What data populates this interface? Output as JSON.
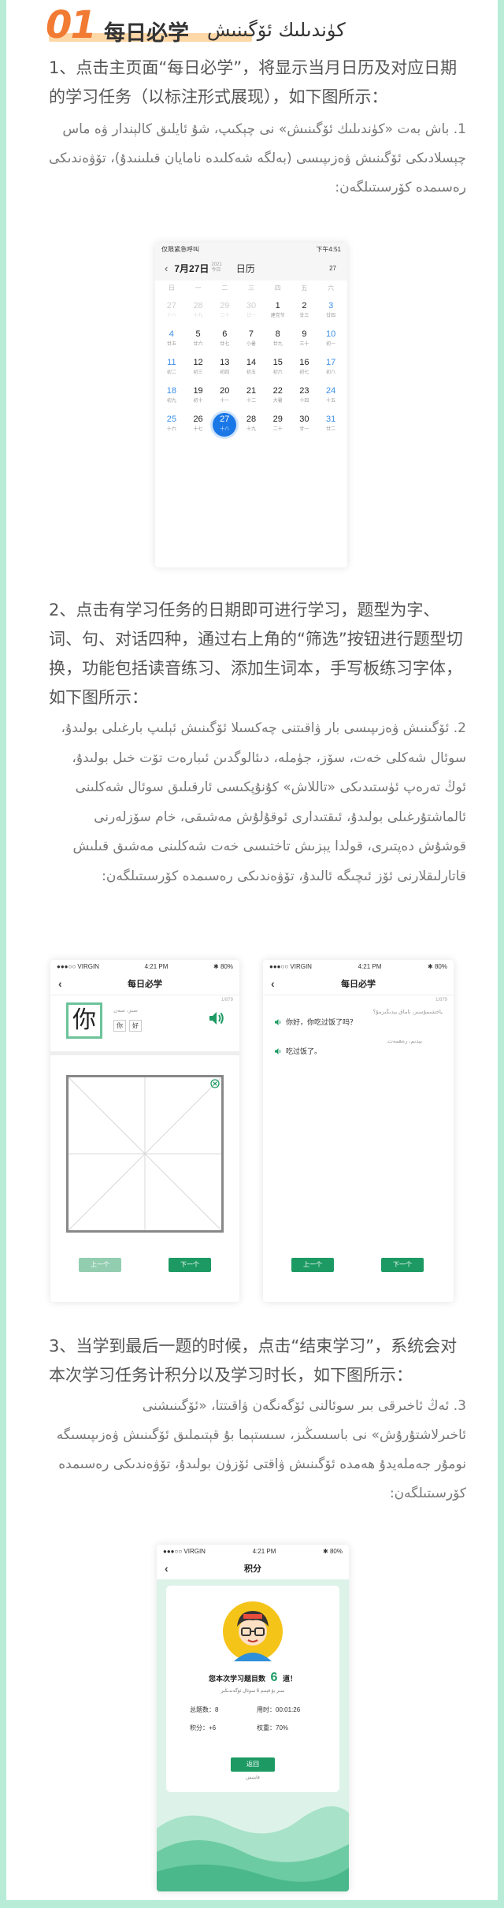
{
  "header": {
    "number": "01",
    "title_zh": "每日必学",
    "title_ug": "كۈندىلىك ئۆگىنىش"
  },
  "sections": [
    {
      "zh": "1、点击主页面“每日必学”，将显示当月日历及对应日期的学习任务（以标注形式展现），如下图所示：",
      "ug": "1. باش بەت «كۈندىلىك ئۆگىنىش» نى چېكىپ، شۇ ئايلىق كالېندار ۋە ماس چېسلادىكى ئۆگىنىش ۋەزىپىسى (بەلگە شەكلىدە نامايان قىلىنىدۇ)، تۆۋەندىكى رەسىمدە كۆرسىتىلگەن:"
    },
    {
      "zh": "2、点击有学习任务的日期即可进行学习，题型为字、词、句、对话四种，通过右上角的“筛选”按钮进行题型切换，功能包括读音练习、添加生词本，手写板练习字体，如下图所示：",
      "ug": "2. ئۆگىنىش ۋەزىپىسى بار ۋاقىتنى چەكسىلا ئۆگىنىش ئېلىپ بارغىلى بولىدۇ، سوئال شەكلى خەت، سۆز، جۈملە، دىئالوگدىن ئىبارەت تۆت خىل بولىدۇ، ئوڭ تەرەپ ئۈستىدىكى «تاللاش» كۇنۇپكىسى ئارقىلىق سوئال شەكلىنى ئالماشتۇرغىلى بولىدۇ، ئىقتىدارى ئوقۇلۇش مەشىقى، خام سۆزلەرنى قوشۇش دەپتىرى، قولدا يېزىش تاختىسى خەت شەكلىنى مەشىق قىلىش قاتارلىقلارنى ئۆز ئىچىگە ئالىدۇ، تۆۋەندىكى رەسىمدە كۆرسىتىلگەن:"
    },
    {
      "zh": "3、当学到最后一题的时候，点击“结束学习”，系统会对本次学习任务计积分以及学习时长，如下图所示：",
      "ug": "3. ئەڭ ئاخىرقى بىر سوئالنى ئۆگەنگەن ۋاقىتتا، «ئۆگىنىشنى ئاخىرلاشتۇرۇش» نى باسسىڭىز، سىستېما بۇ قېتىملىق ئۆگىنىش ۋەزىپىسىگە نومۇر جەملەيدۇ ھەمدە ئۆگىنىش ۋاقتى ئۆزۈن بولىدۇ، تۆۋەندىكى رەسىمدە كۆرسىتىلگەن:"
    }
  ],
  "calendar": {
    "status_left": "仅限紧急呼叫",
    "status_right": "下午4:51",
    "month_title": "7月27日",
    "year_label": "2021",
    "weekday_sub": "今日",
    "tab": "日历",
    "right_badge": "27",
    "weekdays": [
      "日",
      "一",
      "二",
      "三",
      "四",
      "五",
      "六"
    ],
    "days": [
      {
        "d": "27",
        "s": "十八",
        "dim": true
      },
      {
        "d": "28",
        "s": "十九",
        "dim": true
      },
      {
        "d": "29",
        "s": "二十",
        "dim": true
      },
      {
        "d": "30",
        "s": "廿一",
        "dim": true
      },
      {
        "d": "1",
        "s": "建党节"
      },
      {
        "d": "2",
        "s": "廿三"
      },
      {
        "d": "3",
        "s": "廿四",
        "we": true
      },
      {
        "d": "4",
        "s": "廿五",
        "we": true
      },
      {
        "d": "5",
        "s": "廿六"
      },
      {
        "d": "6",
        "s": "廿七"
      },
      {
        "d": "7",
        "s": "小暑"
      },
      {
        "d": "8",
        "s": "廿九"
      },
      {
        "d": "9",
        "s": "三十"
      },
      {
        "d": "10",
        "s": "初一",
        "we": true
      },
      {
        "d": "11",
        "s": "初二",
        "we": true
      },
      {
        "d": "12",
        "s": "初三"
      },
      {
        "d": "13",
        "s": "初四"
      },
      {
        "d": "14",
        "s": "初五"
      },
      {
        "d": "15",
        "s": "初六"
      },
      {
        "d": "16",
        "s": "初七"
      },
      {
        "d": "17",
        "s": "初八",
        "we": true
      },
      {
        "d": "18",
        "s": "初九",
        "we": true
      },
      {
        "d": "19",
        "s": "初十"
      },
      {
        "d": "20",
        "s": "十一"
      },
      {
        "d": "21",
        "s": "十二"
      },
      {
        "d": "22",
        "s": "大暑"
      },
      {
        "d": "23",
        "s": "十四"
      },
      {
        "d": "24",
        "s": "十五",
        "we": true
      },
      {
        "d": "25",
        "s": "十六",
        "we": true
      },
      {
        "d": "26",
        "s": "十七"
      },
      {
        "d": "27",
        "s": "十八",
        "sel": true
      },
      {
        "d": "28",
        "s": "十九"
      },
      {
        "d": "29",
        "s": "二十"
      },
      {
        "d": "30",
        "s": "廿一"
      },
      {
        "d": "31",
        "s": "廿二",
        "we": true
      }
    ]
  },
  "phone_word": {
    "carrier": "VIRGIN",
    "time": "4:21 PM",
    "battery": "80%",
    "title": "每日必学",
    "progress": "1/879",
    "character": "你",
    "meaning_ug": "سىز، سەن",
    "chips": [
      "你",
      "好"
    ],
    "prev": "上一个",
    "next": "下一个"
  },
  "phone_dialog": {
    "carrier": "VIRGIN",
    "time": "4:21 PM",
    "battery": "80%",
    "title": "每日必学",
    "progress": "1/879",
    "line1_ug": "ياخشىمۇسىز، تاماق يېدىڭىزمۇ؟",
    "line1_zh": "你好，你吃过饭了吗？",
    "line2_ug": "يېدىم، رەھمەت.",
    "line2_zh": "吃过饭了。",
    "prev": "上一个",
    "next": "下一个"
  },
  "phone_score": {
    "carrier": "VIRGIN",
    "time": "4:21 PM",
    "battery": "80%",
    "title": "积分",
    "summary_prefix": "您本次学习题目数",
    "summary_count": "6",
    "summary_suffix": "道！",
    "summary_ug": "سىز بۇ قېتىم 6 سوئال ئۆگەندىڭىز",
    "total_label": "总题数：8",
    "time_label": "用时：00:01:26",
    "score_label": "积分：+6",
    "weight_label": "权重：70%",
    "button": "返回",
    "button_sub": "قايتىش",
    "colors": {
      "accent": "#1d9a63",
      "wave": "#5fc79e"
    }
  }
}
